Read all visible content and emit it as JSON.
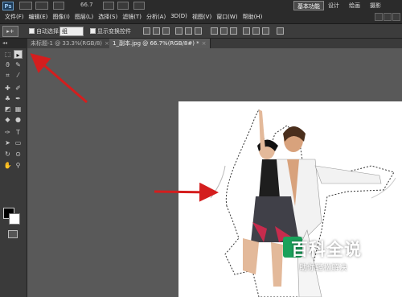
{
  "app": {
    "logo": "Ps",
    "zoom": "66.7",
    "workspaces": [
      "基本功能",
      "设计",
      "绘画",
      "摄影"
    ],
    "active_workspace": "基本功能"
  },
  "menu": [
    "文件(F)",
    "编辑(E)",
    "图像(I)",
    "图层(L)",
    "选择(S)",
    "滤镜(T)",
    "分析(A)",
    "3D(D)",
    "视图(V)",
    "窗口(W)",
    "帮助(H)"
  ],
  "options": {
    "auto_select_label": "自动选择:",
    "auto_select_value": "组",
    "show_transform_label": "显示变换控件"
  },
  "tabs": [
    {
      "label": "未标题-1 @ 33.3%(RGB/8)",
      "close": "×"
    },
    {
      "label": "1_副本.jpg @ 66.7%(RGB/8#) *",
      "close": "×"
    }
  ],
  "watermark": {
    "title": "百科全说",
    "subtitle": "助你轻松解决"
  },
  "colors": {
    "arrow": "#d41e1e",
    "watermark_green": "#1aa15b"
  }
}
